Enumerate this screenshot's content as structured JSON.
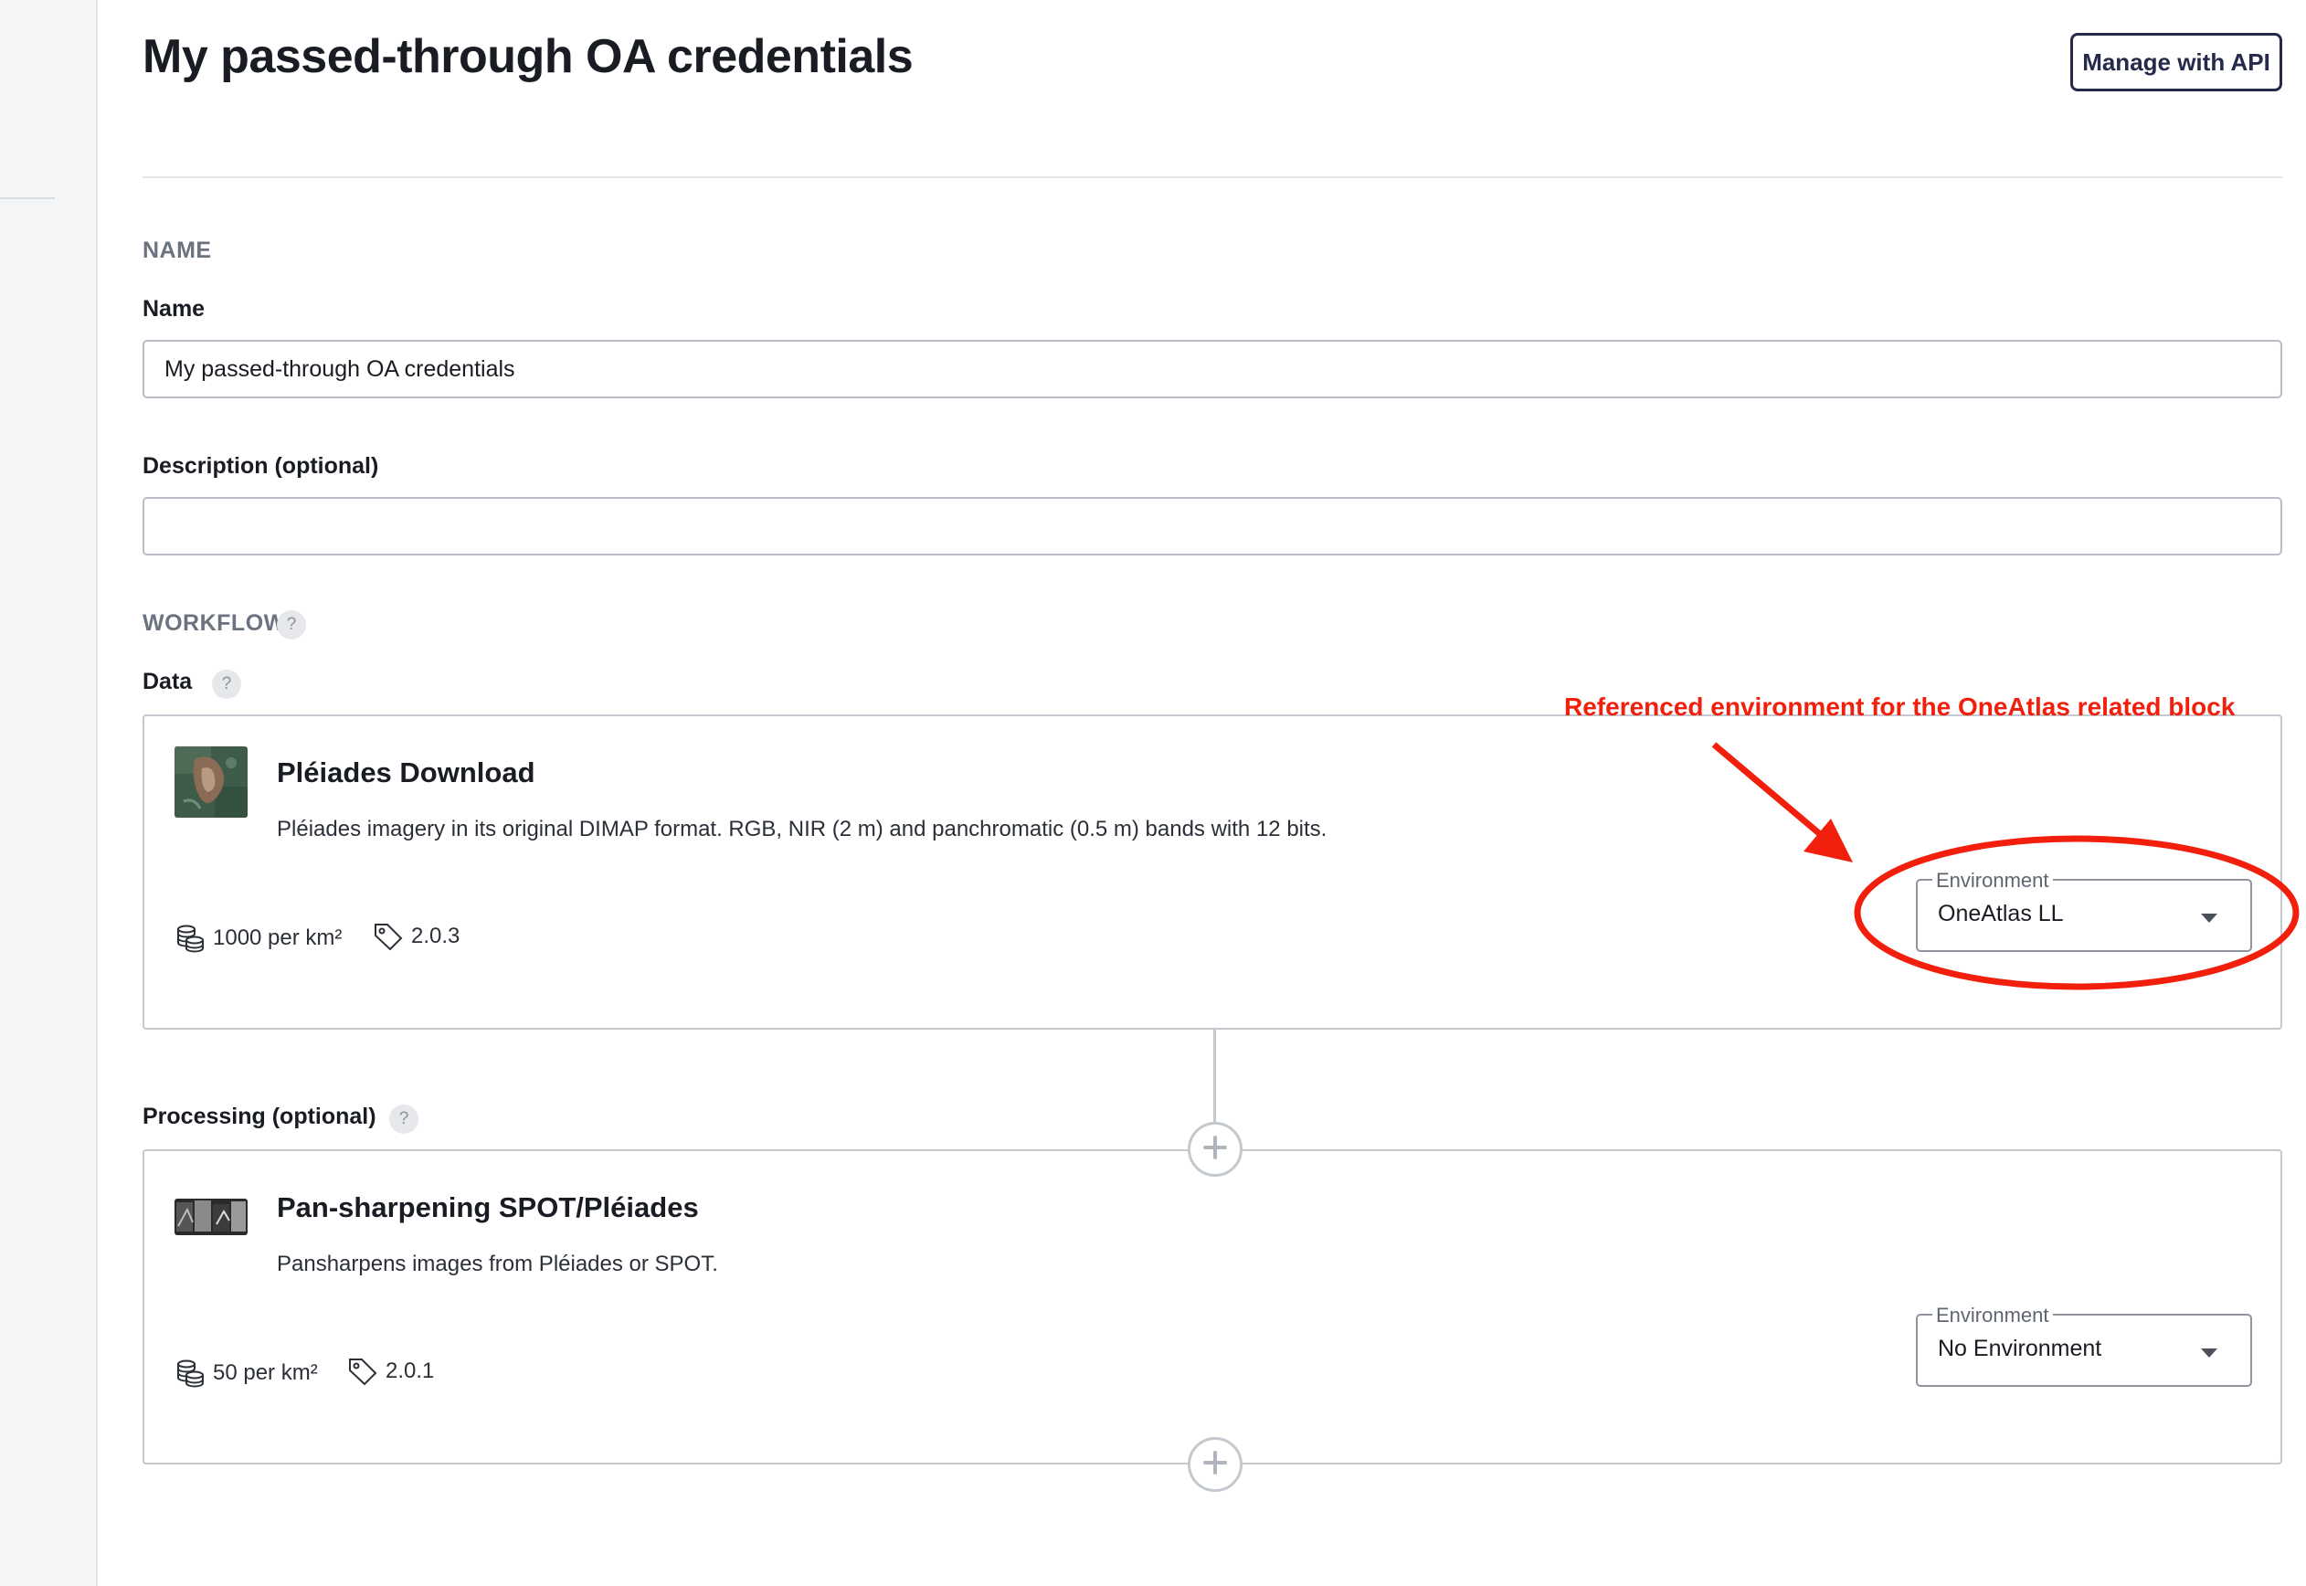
{
  "header": {
    "title": "My passed-through OA credentials",
    "api_button_label": "Manage with API"
  },
  "form": {
    "name_section": "NAME",
    "name_label": "Name",
    "name_value": "My passed-through OA credentials",
    "description_label": "Description (optional)",
    "description_value": "",
    "workflow_section": "WORKFLOW",
    "help_glyph": "?",
    "data_label": "Data",
    "processing_label": "Processing (optional)"
  },
  "blocks": [
    {
      "title": "Pléiades Download",
      "description": "Pléiades imagery in its original DIMAP format. RGB, NIR (2 m) and panchromatic (0.5 m) bands with 12 bits.",
      "credits": "1000 per km²",
      "version": "2.0.3",
      "environment_label": "Environment",
      "environment_value": "OneAtlas LL"
    },
    {
      "title": "Pan-sharpening SPOT/Pléiades",
      "description": "Pansharpens images from Pléiades or SPOT.",
      "credits": "50 per km²",
      "version": "2.0.1",
      "environment_label": "Environment",
      "environment_value": "No Environment"
    }
  ],
  "annotation": {
    "text": "Referenced environment for the OneAtlas related block",
    "color": "#f21f0c"
  },
  "icons": {
    "credits": "coins-icon",
    "version": "tag-icon",
    "help": "question-icon",
    "add": "plus-icon",
    "dropdown": "caret-down-icon"
  },
  "colors": {
    "primary": "#252a4a",
    "annotation": "#f21f0c",
    "border": "#c4c8cf",
    "muted_label": "#6b7280"
  }
}
